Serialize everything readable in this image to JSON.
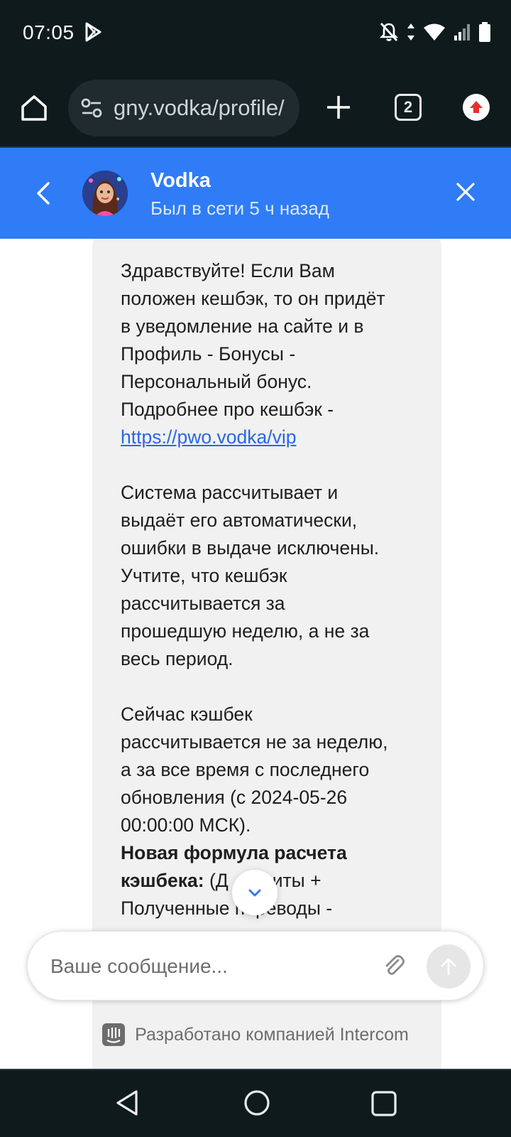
{
  "status_bar": {
    "time": "07:05",
    "icons": [
      "google-play-icon",
      "notifications-off-icon",
      "data-arrows-icon",
      "wifi-icon",
      "signal-icon",
      "battery-icon"
    ]
  },
  "browser": {
    "url": "gny.vodka/profile/",
    "tab_count": "2",
    "icons": [
      "home-icon",
      "site-settings-icon",
      "new-tab-plus-icon",
      "tab-switcher-icon",
      "update-arrow-icon"
    ]
  },
  "chat_header": {
    "agent_name": "Vodka",
    "agent_status": "Был в сети 5 ч назад"
  },
  "message": {
    "p1_lines": [
      "Здравствуйте! Если Вам",
      "положен кешбэк, то он придёт",
      "в уведомление на сайте и в",
      "Профиль - Бонусы -",
      "Персональный бонус.",
      "Подробнее про кешбэк -"
    ],
    "link": "https://pwo.vodka/vip",
    "p2_lines": [
      "Система рассчитывает и",
      "выдаёт его автоматически,",
      "ошибки в выдаче исключены.",
      "Учтите, что кешбэк",
      "рассчитывается за",
      "прошедшую неделю, а не за",
      "весь период."
    ],
    "p3_lines": [
      "Сейчас кэшбек",
      "рассчитывается не за неделю,",
      "а за все время с последнего",
      "обновления (с 2024-05-26",
      "00:00:00 МСК)."
    ],
    "formula_bold": "Новая формула расчета",
    "formula_bold2": "кэшбека:",
    "formula_rest": " (Д",
    "formula_rest_after": "иты +",
    "formula_line3": "Полученные переводы -"
  },
  "composer": {
    "placeholder": "Ваше сообщение..."
  },
  "footer": {
    "powered_by": "Разработано компанией Intercom"
  },
  "colors": {
    "header_blue": "#2f7cf6",
    "bubble_bg": "#f1f1f1",
    "link_blue": "#2668e6",
    "system_dark": "#0f1a1c"
  }
}
